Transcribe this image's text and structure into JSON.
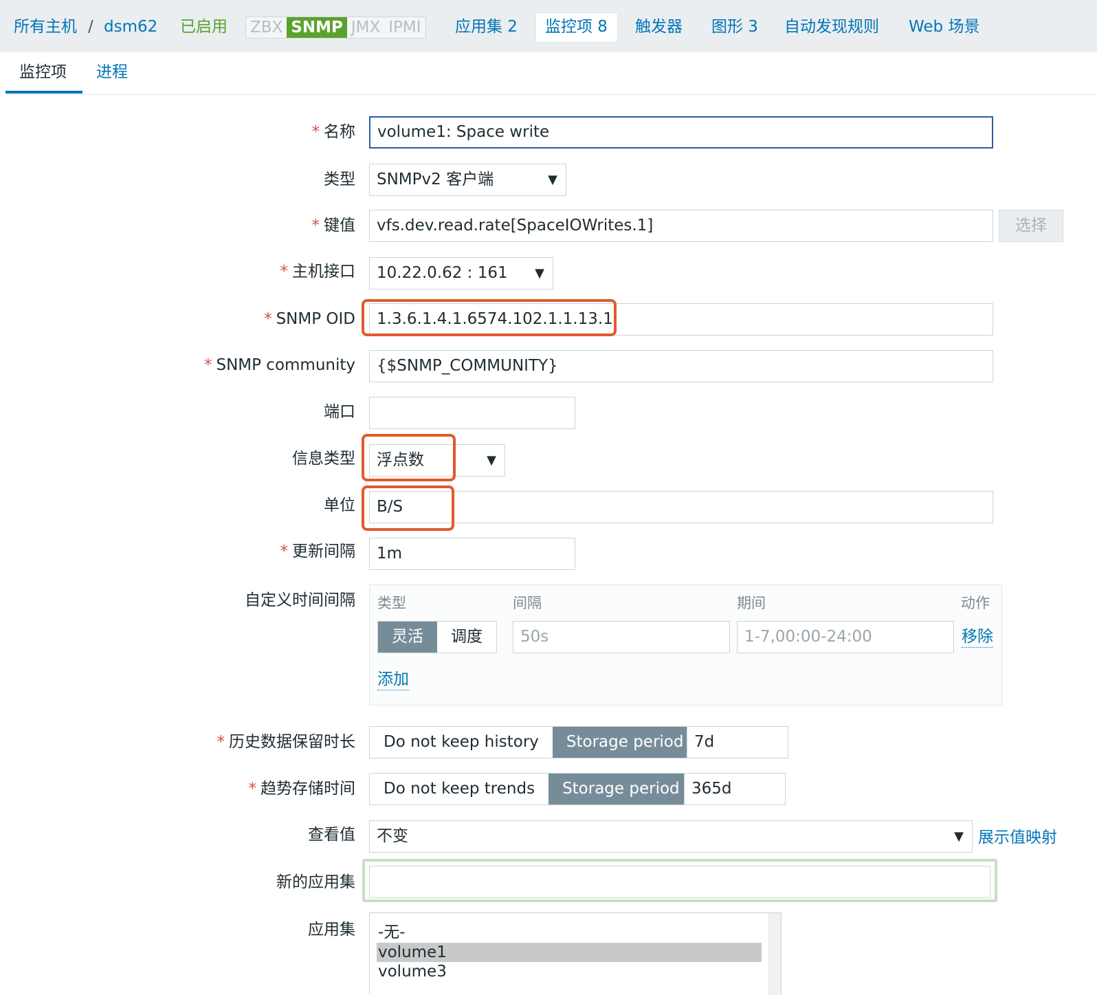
{
  "nav": {
    "all_hosts": "所有主机",
    "separator": "/",
    "host": "dsm62",
    "enabled": "已启用",
    "badges": [
      "ZBX",
      "SNMP",
      "JMX",
      "IPMI"
    ],
    "applications": "应用集 2",
    "items": "监控项 8",
    "triggers": "触发器",
    "graphs": "图形 3",
    "discovery": "自动发现规则",
    "web": "Web 场景"
  },
  "tabs": [
    "监控项",
    "进程"
  ],
  "form": {
    "name_label": "名称",
    "name_value": "volume1: Space write",
    "type_label": "类型",
    "type_value": "SNMPv2 客户端",
    "key_label": "键值",
    "key_value": "vfs.dev.read.rate[SpaceIOWrites.1]",
    "select_button": "选择",
    "interface_label": "主机接口",
    "interface_value": "10.22.0.62 : 161",
    "oid_label": "SNMP OID",
    "oid_value": "1.3.6.1.4.1.6574.102.1.1.13.1",
    "community_label": "SNMP community",
    "community_value": "{$SNMP_COMMUNITY}",
    "port_label": "端口",
    "port_value": "",
    "info_type_label": "信息类型",
    "info_type_value": "浮点数",
    "units_label": "单位",
    "units_value": "B/S",
    "interval_label": "更新间隔",
    "interval_value": "1m",
    "custom_label": "自定义时间间隔",
    "custom": {
      "col_type": "类型",
      "col_interval": "间隔",
      "col_period": "期间",
      "col_action": "动作",
      "flexible": "灵活",
      "scheduling": "调度",
      "interval_placeholder": "50s",
      "period_placeholder": "1-7,00:00-24:00",
      "remove": "移除",
      "add": "添加"
    },
    "history_label": "历史数据保留时长",
    "history_no": "Do not keep history",
    "history_storage": "Storage period",
    "history_value": "7d",
    "trends_label": "趋势存储时间",
    "trends_no": "Do not keep trends",
    "trends_storage": "Storage period",
    "trends_value": "365d",
    "show_value_label": "查看值",
    "show_value_value": "不变",
    "value_mapping_link": "展示值映射",
    "new_app_label": "新的应用集",
    "new_app_value": "",
    "apps_label": "应用集",
    "apps_options": [
      "-无-",
      "volume1",
      "volume3"
    ]
  },
  "colors": {
    "link": "#0275b8",
    "enabled": "#59a22e",
    "highlight": "#e05a2d",
    "selected_segment": "#768d99"
  }
}
